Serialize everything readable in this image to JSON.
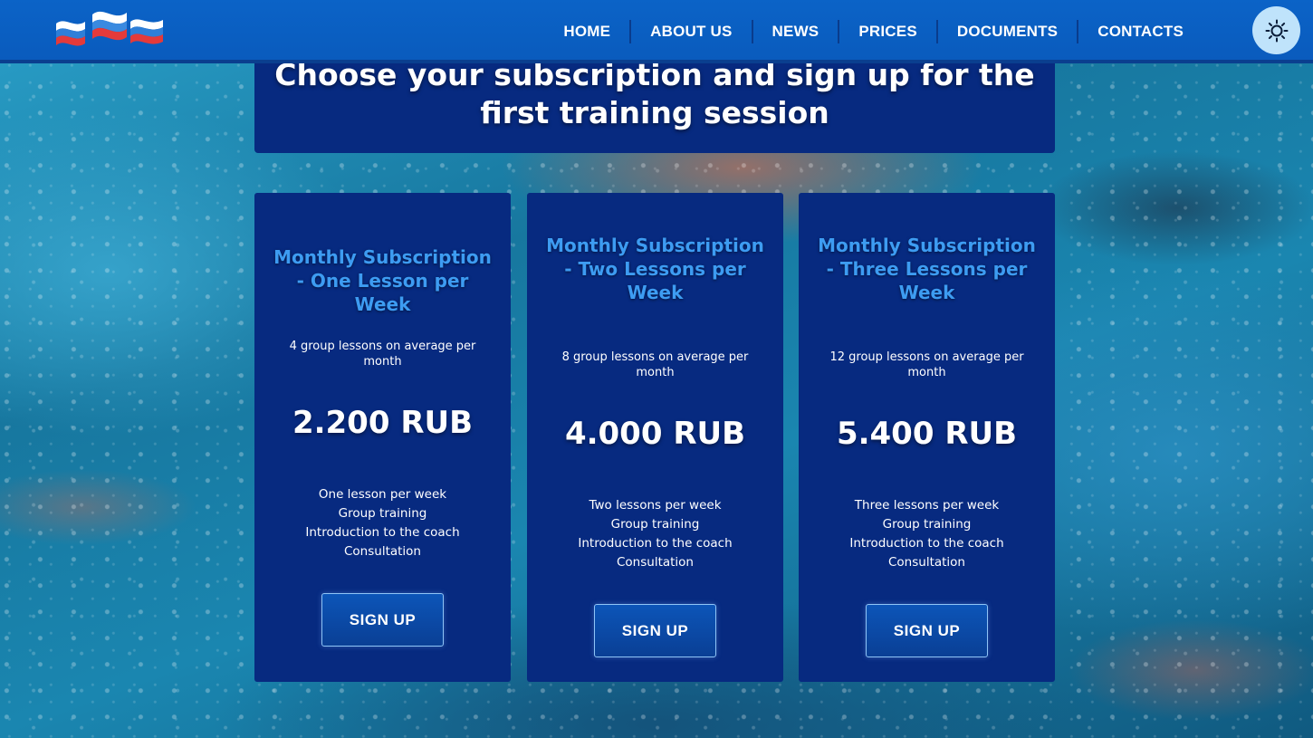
{
  "header": {
    "nav": [
      {
        "label": "HOME"
      },
      {
        "label": "ABOUT US"
      },
      {
        "label": "NEWS"
      },
      {
        "label": "PRICES"
      },
      {
        "label": "DOCUMENTS"
      },
      {
        "label": "CONTACTS"
      }
    ],
    "logo_icon": "flag-waves-logo",
    "theme_icon": "sun-icon"
  },
  "title": "Choose your subscription and sign up for the first training session",
  "cards": [
    {
      "title": "Monthly Subscription - One Lesson per Week",
      "subtitle": "4 group lessons on average per month",
      "price": "2.200 RUB",
      "features": [
        "One lesson per week",
        "Group training",
        "Introduction to the coach",
        "Consultation"
      ],
      "button": "SIGN UP"
    },
    {
      "title": "Monthly Subscription - Two Lessons per Week",
      "subtitle": "8 group lessons on average per month",
      "price": "4.000 RUB",
      "features": [
        "Two lessons per week",
        "Group training",
        "Introduction to the coach",
        "Consultation"
      ],
      "button": "SIGN UP"
    },
    {
      "title": "Monthly Subscription - Three Lessons per Week",
      "subtitle": "12 group lessons on average per month",
      "price": "5.400 RUB",
      "features": [
        "Three lessons per week",
        "Group training",
        "Introduction to the coach",
        "Consultation"
      ],
      "button": "SIGN UP"
    }
  ],
  "colors": {
    "header": "#0a5bbd",
    "panel": "#072a80",
    "card_title": "#3d9cf2",
    "toggle_bg": "#bfe3fb"
  }
}
